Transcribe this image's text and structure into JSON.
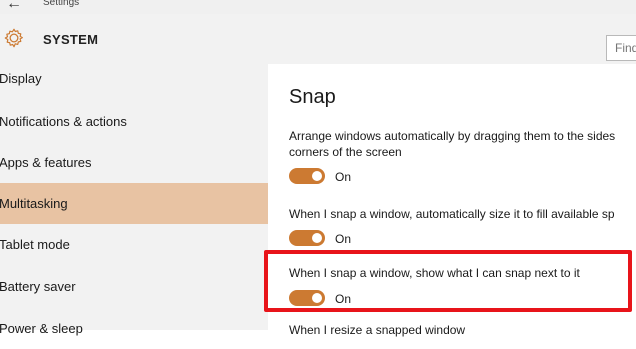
{
  "titlebar": {
    "title": "Settings"
  },
  "header": {
    "section": "SYSTEM",
    "search_placeholder": "Find"
  },
  "sidebar": {
    "items": [
      {
        "label": "Display"
      },
      {
        "label": "Notifications & actions"
      },
      {
        "label": "Apps & features"
      },
      {
        "label": "Multitasking",
        "selected": true
      },
      {
        "label": "Tablet mode"
      },
      {
        "label": "Battery saver"
      },
      {
        "label": "Power & sleep"
      }
    ]
  },
  "main": {
    "title": "Snap",
    "settings": [
      {
        "desc_line1": "Arrange windows automatically by dragging them to the sides",
        "desc_line2": "corners of the screen",
        "state": "On"
      },
      {
        "desc_line1": "When I snap a window, automatically size it to fill available sp",
        "state": "On"
      },
      {
        "desc_line1": "When I snap a window, show what I can snap next to it",
        "state": "On"
      }
    ],
    "next_setting": "When I resize a snapped window"
  },
  "colors": {
    "accent": "#cc7a32",
    "selected_bg": "#e8c3a3",
    "highlight": "#e8141a"
  },
  "icons": {
    "back": "back-arrow-icon",
    "system": "gear-icon"
  }
}
